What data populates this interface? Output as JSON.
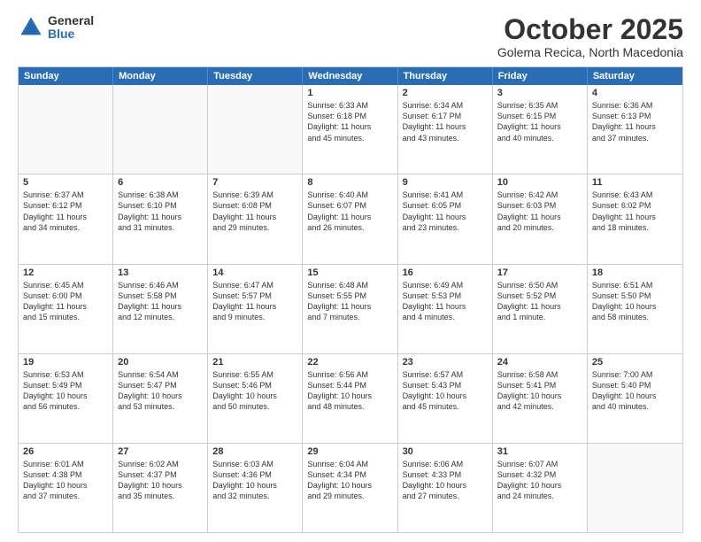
{
  "logo": {
    "general": "General",
    "blue": "Blue"
  },
  "header": {
    "month": "October 2025",
    "location": "Golema Recica, North Macedonia"
  },
  "weekdays": [
    "Sunday",
    "Monday",
    "Tuesday",
    "Wednesday",
    "Thursday",
    "Friday",
    "Saturday"
  ],
  "rows": [
    [
      {
        "day": "",
        "empty": true
      },
      {
        "day": "",
        "empty": true
      },
      {
        "day": "",
        "empty": true
      },
      {
        "day": "1",
        "lines": [
          "Sunrise: 6:33 AM",
          "Sunset: 6:18 PM",
          "Daylight: 11 hours",
          "and 45 minutes."
        ]
      },
      {
        "day": "2",
        "lines": [
          "Sunrise: 6:34 AM",
          "Sunset: 6:17 PM",
          "Daylight: 11 hours",
          "and 43 minutes."
        ]
      },
      {
        "day": "3",
        "lines": [
          "Sunrise: 6:35 AM",
          "Sunset: 6:15 PM",
          "Daylight: 11 hours",
          "and 40 minutes."
        ]
      },
      {
        "day": "4",
        "lines": [
          "Sunrise: 6:36 AM",
          "Sunset: 6:13 PM",
          "Daylight: 11 hours",
          "and 37 minutes."
        ]
      }
    ],
    [
      {
        "day": "5",
        "lines": [
          "Sunrise: 6:37 AM",
          "Sunset: 6:12 PM",
          "Daylight: 11 hours",
          "and 34 minutes."
        ]
      },
      {
        "day": "6",
        "lines": [
          "Sunrise: 6:38 AM",
          "Sunset: 6:10 PM",
          "Daylight: 11 hours",
          "and 31 minutes."
        ]
      },
      {
        "day": "7",
        "lines": [
          "Sunrise: 6:39 AM",
          "Sunset: 6:08 PM",
          "Daylight: 11 hours",
          "and 29 minutes."
        ]
      },
      {
        "day": "8",
        "lines": [
          "Sunrise: 6:40 AM",
          "Sunset: 6:07 PM",
          "Daylight: 11 hours",
          "and 26 minutes."
        ]
      },
      {
        "day": "9",
        "lines": [
          "Sunrise: 6:41 AM",
          "Sunset: 6:05 PM",
          "Daylight: 11 hours",
          "and 23 minutes."
        ]
      },
      {
        "day": "10",
        "lines": [
          "Sunrise: 6:42 AM",
          "Sunset: 6:03 PM",
          "Daylight: 11 hours",
          "and 20 minutes."
        ]
      },
      {
        "day": "11",
        "lines": [
          "Sunrise: 6:43 AM",
          "Sunset: 6:02 PM",
          "Daylight: 11 hours",
          "and 18 minutes."
        ]
      }
    ],
    [
      {
        "day": "12",
        "lines": [
          "Sunrise: 6:45 AM",
          "Sunset: 6:00 PM",
          "Daylight: 11 hours",
          "and 15 minutes."
        ]
      },
      {
        "day": "13",
        "lines": [
          "Sunrise: 6:46 AM",
          "Sunset: 5:58 PM",
          "Daylight: 11 hours",
          "and 12 minutes."
        ]
      },
      {
        "day": "14",
        "lines": [
          "Sunrise: 6:47 AM",
          "Sunset: 5:57 PM",
          "Daylight: 11 hours",
          "and 9 minutes."
        ]
      },
      {
        "day": "15",
        "lines": [
          "Sunrise: 6:48 AM",
          "Sunset: 5:55 PM",
          "Daylight: 11 hours",
          "and 7 minutes."
        ]
      },
      {
        "day": "16",
        "lines": [
          "Sunrise: 6:49 AM",
          "Sunset: 5:53 PM",
          "Daylight: 11 hours",
          "and 4 minutes."
        ]
      },
      {
        "day": "17",
        "lines": [
          "Sunrise: 6:50 AM",
          "Sunset: 5:52 PM",
          "Daylight: 11 hours",
          "and 1 minute."
        ]
      },
      {
        "day": "18",
        "lines": [
          "Sunrise: 6:51 AM",
          "Sunset: 5:50 PM",
          "Daylight: 10 hours",
          "and 58 minutes."
        ]
      }
    ],
    [
      {
        "day": "19",
        "lines": [
          "Sunrise: 6:53 AM",
          "Sunset: 5:49 PM",
          "Daylight: 10 hours",
          "and 56 minutes."
        ]
      },
      {
        "day": "20",
        "lines": [
          "Sunrise: 6:54 AM",
          "Sunset: 5:47 PM",
          "Daylight: 10 hours",
          "and 53 minutes."
        ]
      },
      {
        "day": "21",
        "lines": [
          "Sunrise: 6:55 AM",
          "Sunset: 5:46 PM",
          "Daylight: 10 hours",
          "and 50 minutes."
        ]
      },
      {
        "day": "22",
        "lines": [
          "Sunrise: 6:56 AM",
          "Sunset: 5:44 PM",
          "Daylight: 10 hours",
          "and 48 minutes."
        ]
      },
      {
        "day": "23",
        "lines": [
          "Sunrise: 6:57 AM",
          "Sunset: 5:43 PM",
          "Daylight: 10 hours",
          "and 45 minutes."
        ]
      },
      {
        "day": "24",
        "lines": [
          "Sunrise: 6:58 AM",
          "Sunset: 5:41 PM",
          "Daylight: 10 hours",
          "and 42 minutes."
        ]
      },
      {
        "day": "25",
        "lines": [
          "Sunrise: 7:00 AM",
          "Sunset: 5:40 PM",
          "Daylight: 10 hours",
          "and 40 minutes."
        ]
      }
    ],
    [
      {
        "day": "26",
        "lines": [
          "Sunrise: 6:01 AM",
          "Sunset: 4:38 PM",
          "Daylight: 10 hours",
          "and 37 minutes."
        ]
      },
      {
        "day": "27",
        "lines": [
          "Sunrise: 6:02 AM",
          "Sunset: 4:37 PM",
          "Daylight: 10 hours",
          "and 35 minutes."
        ]
      },
      {
        "day": "28",
        "lines": [
          "Sunrise: 6:03 AM",
          "Sunset: 4:36 PM",
          "Daylight: 10 hours",
          "and 32 minutes."
        ]
      },
      {
        "day": "29",
        "lines": [
          "Sunrise: 6:04 AM",
          "Sunset: 4:34 PM",
          "Daylight: 10 hours",
          "and 29 minutes."
        ]
      },
      {
        "day": "30",
        "lines": [
          "Sunrise: 6:06 AM",
          "Sunset: 4:33 PM",
          "Daylight: 10 hours",
          "and 27 minutes."
        ]
      },
      {
        "day": "31",
        "lines": [
          "Sunrise: 6:07 AM",
          "Sunset: 4:32 PM",
          "Daylight: 10 hours",
          "and 24 minutes."
        ]
      },
      {
        "day": "",
        "empty": true
      }
    ]
  ]
}
